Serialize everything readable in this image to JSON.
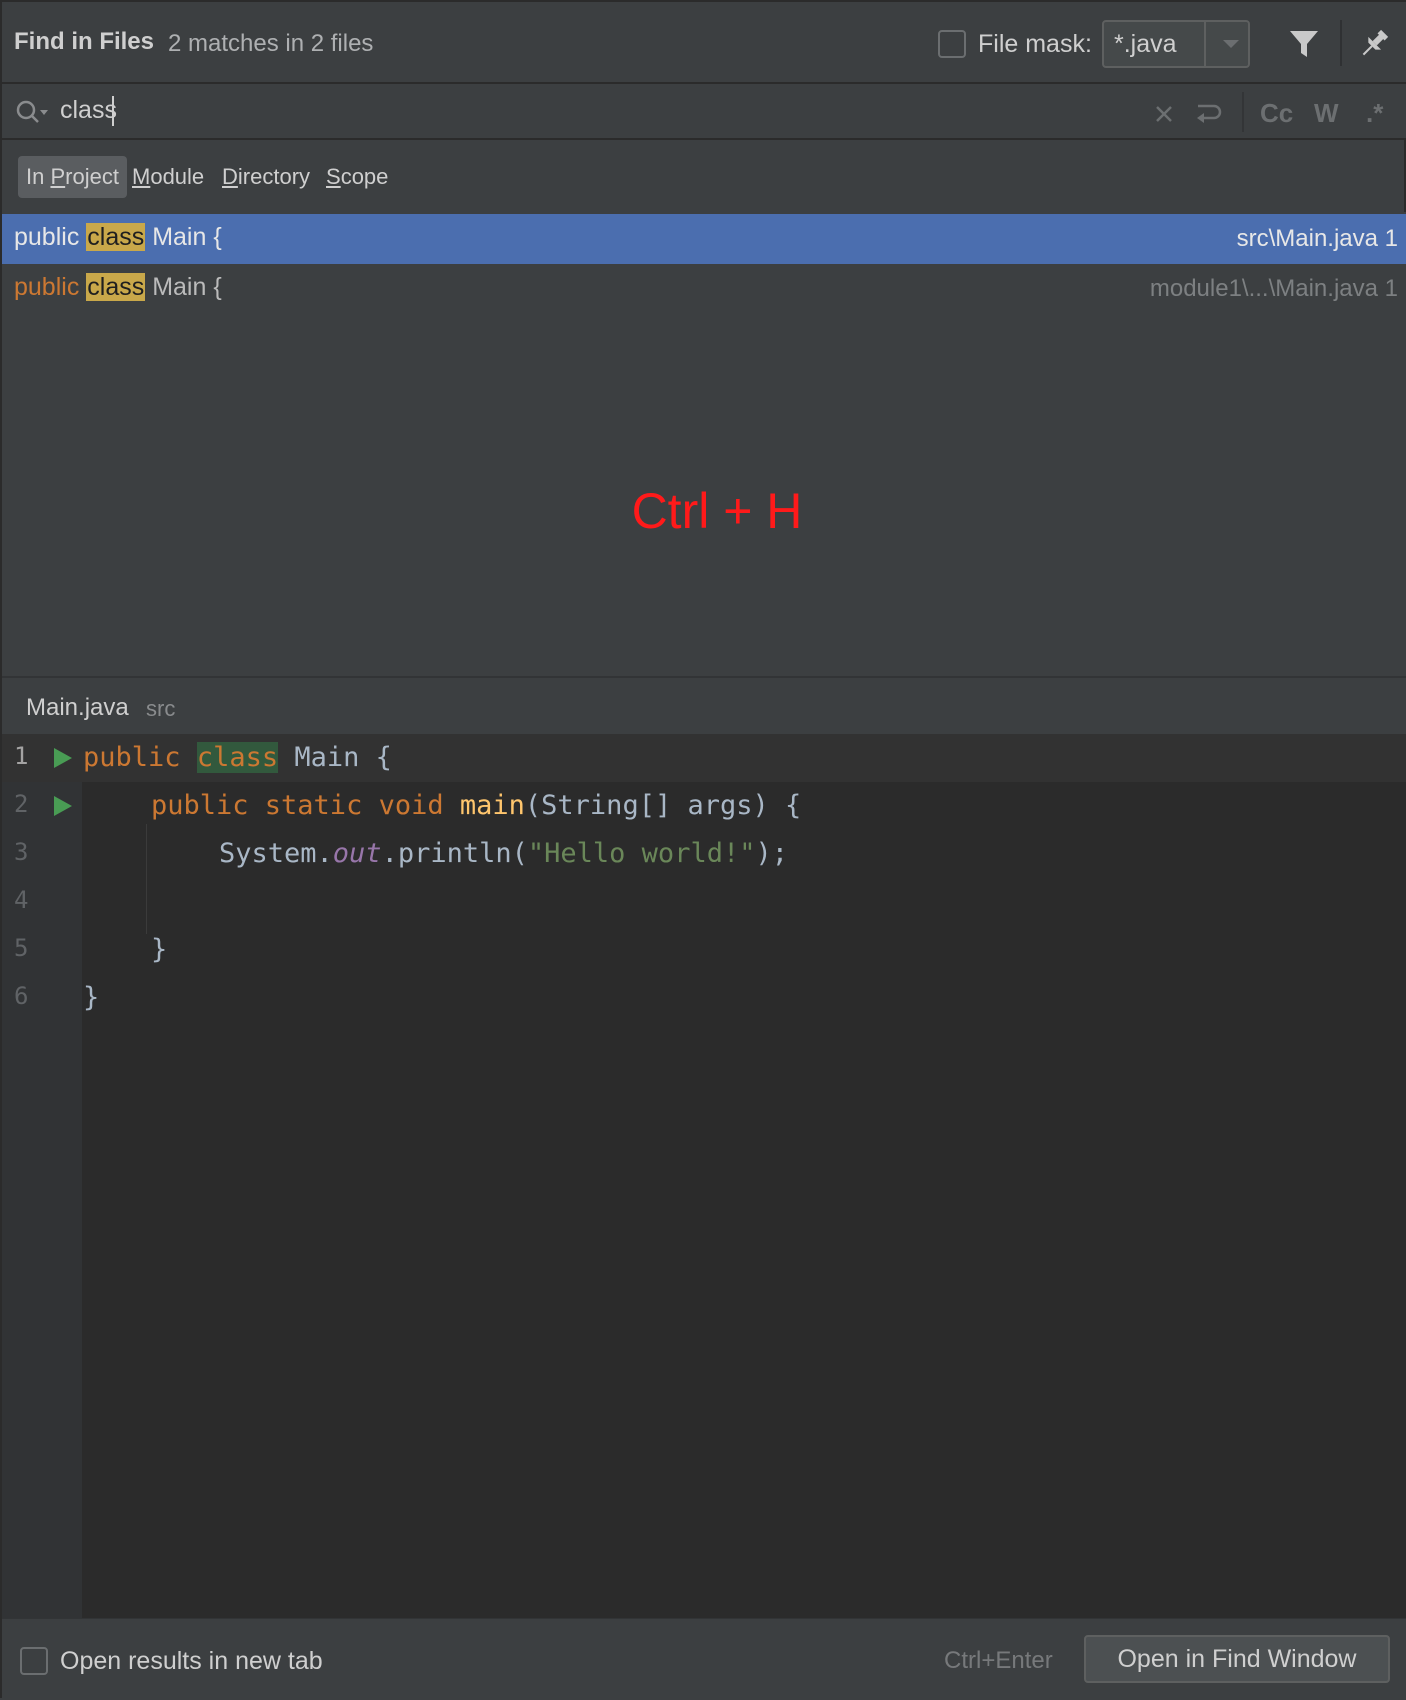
{
  "header": {
    "title": "Find in Files",
    "match_count": "2 matches in 2 files",
    "file_mask_label": "File mask:",
    "file_mask_value": "*.java",
    "file_mask_checked": false
  },
  "search": {
    "query": "class",
    "icons": [
      "search-history-icon",
      "clear-icon",
      "new-line-icon",
      "match-case-icon",
      "words-icon",
      "regex-icon"
    ],
    "match_case_label": "Cc",
    "words_label": "W",
    "regex_label": ".*"
  },
  "scopes": [
    {
      "prefix": "In ",
      "mnemonic": "P",
      "rest": "roject",
      "active": true
    },
    {
      "prefix": "",
      "mnemonic": "M",
      "rest": "odule",
      "active": false
    },
    {
      "prefix": "",
      "mnemonic": "D",
      "rest": "irectory",
      "active": false
    },
    {
      "prefix": "",
      "mnemonic": "S",
      "rest": "cope",
      "active": false
    }
  ],
  "results": [
    {
      "before": "public",
      "match": "class",
      "after": "Main {",
      "path": "src\\Main.java 1",
      "selected": true
    },
    {
      "before": "public",
      "match": "class",
      "after": "Main {",
      "path": "module1\\...\\Main.java 1",
      "selected": false
    }
  ],
  "overlay_text": "Ctrl + H",
  "preview": {
    "file_name": "Main.java",
    "dir": "src",
    "lines": [
      {
        "n": "1",
        "run": true
      },
      {
        "n": "2",
        "run": true
      },
      {
        "n": "3",
        "run": false
      },
      {
        "n": "4",
        "run": false
      },
      {
        "n": "5",
        "run": false
      },
      {
        "n": "6",
        "run": false
      }
    ],
    "code": {
      "l1_public": "public",
      "l1_class": "class",
      "l1_rest": "Main {",
      "l2_kw": "public static void",
      "l2_fn": "main",
      "l2_rest": "(String[] args) {",
      "l3_sys": "System.",
      "l3_out": "out",
      "l3_println": ".println(",
      "l3_str": "\"Hello world!\"",
      "l3_end": ");",
      "l5": "}",
      "l6": "}"
    }
  },
  "footer": {
    "new_tab_label": "Open results in new tab",
    "new_tab_checked": false,
    "shortcut_hint": "Ctrl+Enter",
    "open_button": "Open in Find Window"
  },
  "colors": {
    "selection": "#4b6eaf",
    "match_highlight": "#c9a84a",
    "overlay": "#ff1a1a",
    "keyword": "#cc7832",
    "string": "#6a8759",
    "function": "#ffc66d"
  }
}
